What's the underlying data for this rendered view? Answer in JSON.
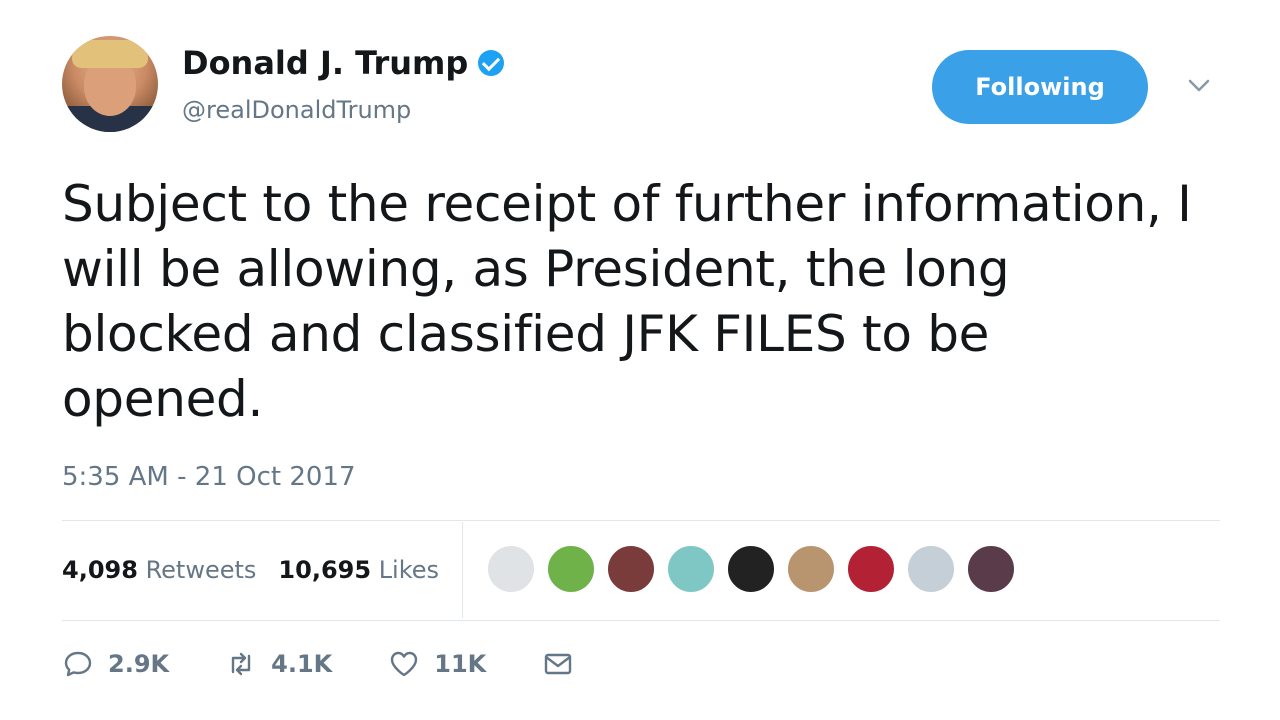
{
  "author": {
    "name": "Donald J. Trump",
    "handle": "@realDonaldTrump",
    "verified": true
  },
  "follow_button": {
    "label": "Following",
    "color": "#3aa0e8"
  },
  "tweet": {
    "lines": [
      "Subject to the receipt of further information, I",
      "will be allowing, as President, the long",
      "blocked and classified JFK FILES to be",
      "opened."
    ],
    "timestamp": "5:35 AM - 21 Oct 2017"
  },
  "stats": {
    "retweets_count": "4,098",
    "retweets_label": "Retweets",
    "likes_count": "10,695",
    "likes_label": "Likes"
  },
  "likers": [
    {
      "icon": "person-in-suit-avatar",
      "color": "#dfe3e6"
    },
    {
      "icon": "landscape-avatar",
      "color": "#6fb24a"
    },
    {
      "icon": "woman-avatar",
      "color": "#7a3b3b"
    },
    {
      "icon": "teal-map-avatar",
      "color": "#7fc7c4"
    },
    {
      "icon": "text-avatar",
      "color": "#222222"
    },
    {
      "icon": "couple-avatar",
      "color": "#b9956f"
    },
    {
      "icon": "us-flag-avatar",
      "color": "#b22234"
    },
    {
      "icon": "default-avatar",
      "color": "#c5cfd7"
    },
    {
      "icon": "group-avatar",
      "color": "#5a3b4a"
    }
  ],
  "actions": {
    "reply_count": "2.9K",
    "retweet_count": "4.1K",
    "like_count": "11K"
  }
}
